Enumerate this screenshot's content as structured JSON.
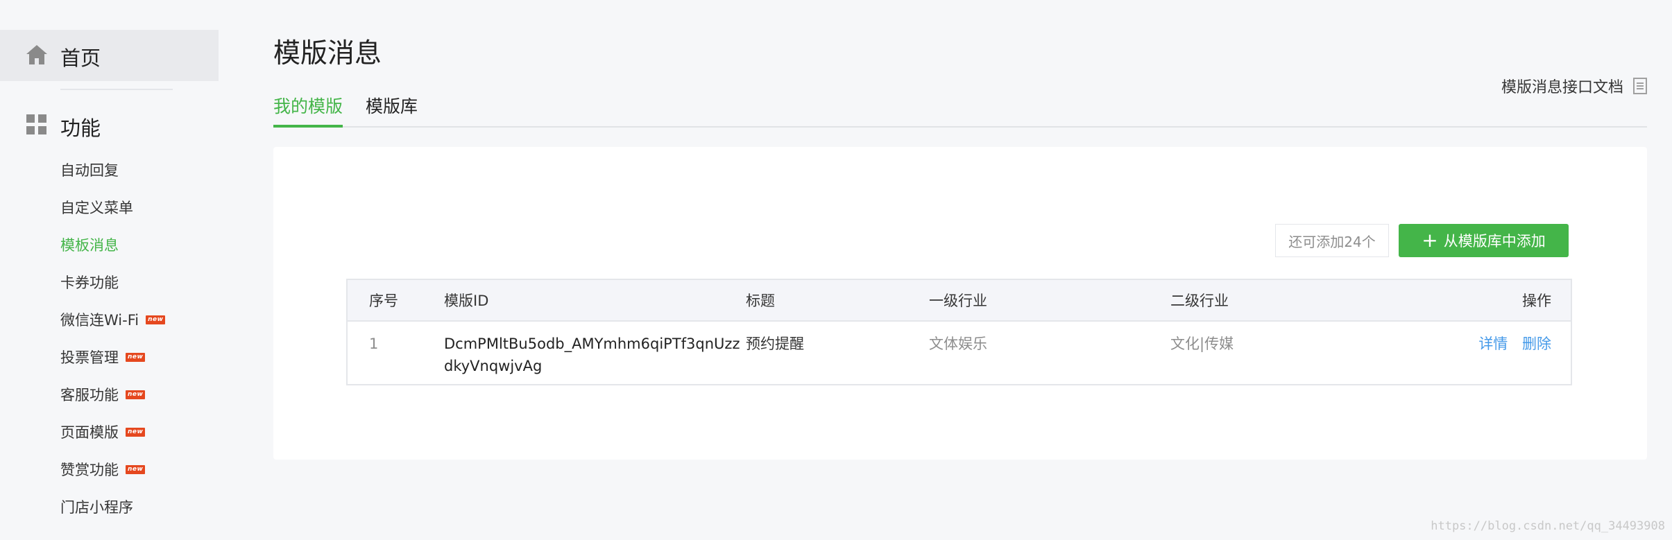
{
  "sidebar": {
    "home": {
      "label": "首页",
      "icon": "home-icon"
    },
    "section": {
      "label": "功能",
      "icon": "grid-icon"
    },
    "items": [
      {
        "label": "自动回复",
        "badge": ""
      },
      {
        "label": "自定义菜单",
        "badge": ""
      },
      {
        "label": "模板消息",
        "badge": "",
        "active": true
      },
      {
        "label": "卡券功能",
        "badge": ""
      },
      {
        "label": "微信连Wi-Fi",
        "badge": "new"
      },
      {
        "label": "投票管理",
        "badge": "new"
      },
      {
        "label": "客服功能",
        "badge": "new"
      },
      {
        "label": "页面模版",
        "badge": "new"
      },
      {
        "label": "赞赏功能",
        "badge": "new"
      },
      {
        "label": "门店小程序",
        "badge": ""
      }
    ]
  },
  "header": {
    "title": "模版消息",
    "doc_link": "模版消息接口文档"
  },
  "tabs": [
    {
      "label": "我的模版",
      "active": true
    },
    {
      "label": "模版库",
      "active": false
    }
  ],
  "toolbar": {
    "quota_text": "还可添加24个",
    "add_button": "从模版库中添加"
  },
  "table": {
    "headers": [
      "序号",
      "模版ID",
      "标题",
      "一级行业",
      "二级行业",
      "操作"
    ],
    "rows": [
      {
        "index": "1",
        "template_id": "DcmPMltBu5odb_AMYmhm6qiPTf3qnUzzdkyVnqwjvAg",
        "title": "预约提醒",
        "industry_primary": "文体娱乐",
        "industry_secondary": "文化|传媒",
        "actions": [
          "详情",
          "删除"
        ]
      }
    ]
  },
  "watermark": "https://blog.csdn.net/qq_34493908",
  "colors": {
    "accent": "#44b549",
    "link": "#459ae9",
    "badge": "#e5481f"
  }
}
